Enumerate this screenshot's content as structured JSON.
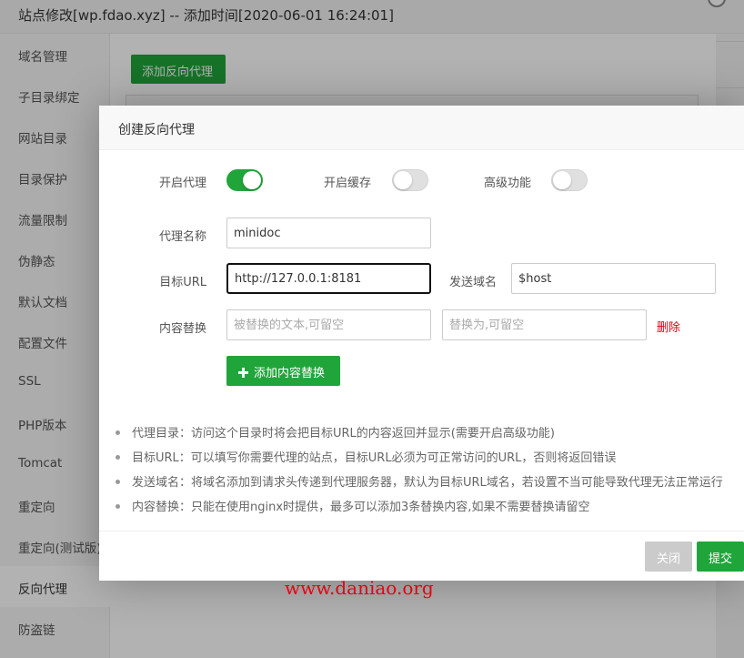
{
  "window": {
    "title": "站点修改[wp.fdao.xyz] -- 添加时间[2020-06-01 16:24:01]"
  },
  "sidebar": {
    "items": [
      {
        "label": "域名管理"
      },
      {
        "label": "子目录绑定"
      },
      {
        "label": "网站目录"
      },
      {
        "label": "目录保护"
      },
      {
        "label": "流量限制"
      },
      {
        "label": "伪静态"
      },
      {
        "label": "默认文档"
      },
      {
        "label": "配置文件"
      },
      {
        "label": "SSL"
      },
      {
        "label": "PHP版本"
      },
      {
        "label": "Tomcat"
      },
      {
        "label": "重定向"
      },
      {
        "label": "重定向(测试版)"
      },
      {
        "label": "反向代理",
        "active": true
      },
      {
        "label": "防盗链"
      }
    ]
  },
  "main": {
    "add_button_label": "添加反向代理"
  },
  "modal": {
    "title": "创建反向代理",
    "toggles": {
      "enable_proxy": {
        "label": "开启代理",
        "on": true
      },
      "enable_cache": {
        "label": "开启缓存",
        "on": false
      },
      "advanced": {
        "label": "高级功能",
        "on": false
      }
    },
    "proxy_name": {
      "label": "代理名称",
      "value": "minidoc"
    },
    "target_url": {
      "label": "目标URL",
      "value": "http://127.0.0.1:8181"
    },
    "send_domain": {
      "label": "发送域名",
      "value": "$host"
    },
    "content_replace": {
      "label": "内容替换",
      "from_placeholder": "被替换的文本,可留空",
      "to_placeholder": "替换为,可留空",
      "delete_label": "删除"
    },
    "add_replace_label": "添加内容替换",
    "tips": [
      "代理目录：访问这个目录时将会把目标URL的内容返回并显示(需要开启高级功能)",
      "目标URL：可以填写你需要代理的站点，目标URL必须为可正常访问的URL，否则将返回错误",
      "发送域名：将域名添加到请求头传递到代理服务器，默认为目标URL域名，若设置不当可能导致代理无法正常运行",
      "内容替换：只能在使用nginx时提供，最多可以添加3条替换内容,如果不需要替换请留空"
    ],
    "footer": {
      "close_label": "关闭",
      "submit_label": "提交"
    }
  },
  "watermark": "www.daniao.org",
  "colors": {
    "accent_green": "#20a53a",
    "danger_red": "#e60012"
  }
}
